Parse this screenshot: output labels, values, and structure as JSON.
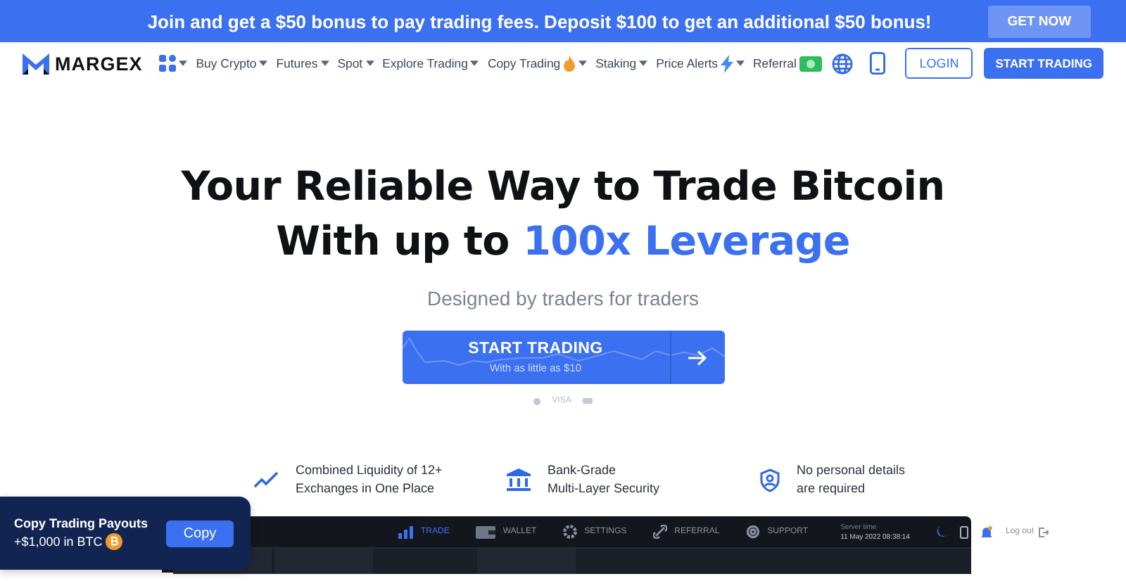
{
  "promo_banner": {
    "text": "Join and get a $50 bonus to pay trading fees. Deposit $100 to get an additional $50 bonus!",
    "button": "GET NOW"
  },
  "nav": {
    "logo": "MARGEX",
    "items": [
      {
        "label": "Buy Crypto",
        "kind": "plain",
        "dropdown": true
      },
      {
        "label": "Futures",
        "kind": "plain",
        "dropdown": true
      },
      {
        "label": "Spot",
        "kind": "plain",
        "dropdown": true
      },
      {
        "label": "Explore Trading",
        "kind": "plain",
        "dropdown": true
      },
      {
        "label": "Copy Trading",
        "kind": "fire",
        "dropdown": true
      },
      {
        "label": "Staking",
        "kind": "plain",
        "dropdown": true
      },
      {
        "label": "Price Alerts",
        "kind": "bolt",
        "dropdown": true
      },
      {
        "label": "Referral",
        "kind": "cash",
        "dropdown": false
      }
    ],
    "login": "LOGIN",
    "start": "START TRADING"
  },
  "hero": {
    "title_line1": "Your Reliable Way to Trade Bitcoin",
    "title_line2_prefix": "With up to ",
    "title_line2_highlight": "100x Leverage",
    "subtitle": "Designed by traders for traders",
    "cta": "START TRADING",
    "cta_sub": "With as little as $10",
    "payment_label": "VISA"
  },
  "features": [
    {
      "kind": "chart",
      "lines": [
        "Combined Liquidity of 12+",
        "Exchanges in One Place"
      ]
    },
    {
      "kind": "bank",
      "lines": [
        "Bank-Grade",
        "Multi-Layer Security"
      ]
    },
    {
      "kind": "shield",
      "lines": [
        "No personal details",
        "are required"
      ]
    }
  ],
  "app_preview": {
    "tabs": [
      {
        "label": "TRADE",
        "kind": "bars",
        "selected": true
      },
      {
        "label": "WALLET",
        "kind": "wallet",
        "selected": false
      },
      {
        "label": "SETTINGS",
        "kind": "gear",
        "selected": false
      },
      {
        "label": "REFERRAL",
        "kind": "link",
        "selected": false
      },
      {
        "label": "SUPPORT",
        "kind": "lifebuoy",
        "selected": false
      }
    ],
    "server_time_label": "Server time",
    "server_time": "11 May 2022 08:38:14",
    "logout": "Log out"
  },
  "popup": {
    "title": "Copy Trading Payouts",
    "amount": "+$1,000 in BTC",
    "button": "Copy"
  }
}
